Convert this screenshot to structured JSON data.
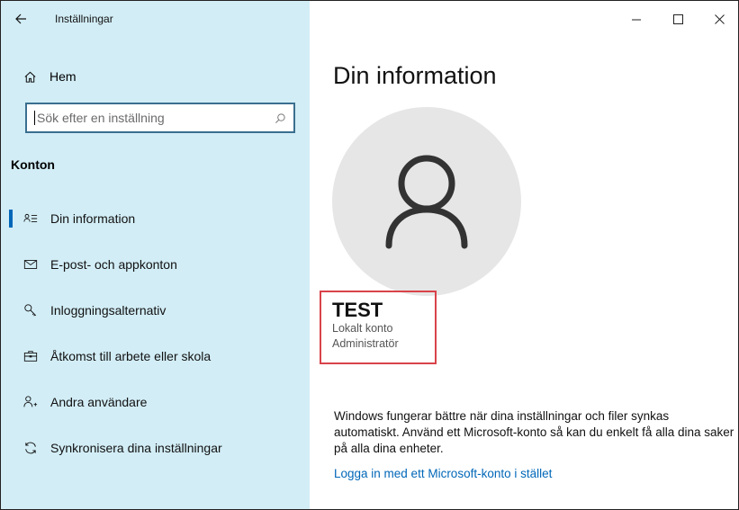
{
  "app": {
    "title": "Inställningar"
  },
  "sidebar": {
    "home_label": "Hem",
    "search": {
      "placeholder": "Sök efter en inställning"
    },
    "section_heading": "Konton",
    "items": [
      {
        "label": "Din information",
        "icon": "person-card-icon",
        "active": true
      },
      {
        "label": "E-post- och appkonton",
        "icon": "mail-icon"
      },
      {
        "label": "Inloggningsalternativ",
        "icon": "key-icon"
      },
      {
        "label": "Åtkomst till arbete eller skola",
        "icon": "briefcase-icon"
      },
      {
        "label": "Andra användare",
        "icon": "add-person-icon"
      },
      {
        "label": "Synkronisera dina inställningar",
        "icon": "sync-icon"
      }
    ]
  },
  "main": {
    "heading": "Din information",
    "user": {
      "name": "TEST",
      "account_type": "Lokalt konto",
      "role": "Administratör"
    },
    "info_text": "Windows fungerar bättre när dina inställningar och filer synkas automatiskt. Använd ett Microsoft-konto så kan du enkelt få alla dina saker på alla dina enheter.",
    "link_text": "Logga in med ett Microsoft-konto i stället"
  },
  "colors": {
    "sidebar_bg": "#d2edf6",
    "accent": "#0067b8",
    "highlight_border": "#d9434a",
    "avatar_bg": "#e6e6e6"
  }
}
